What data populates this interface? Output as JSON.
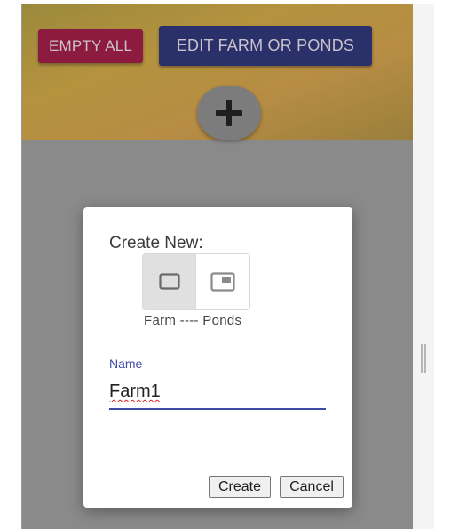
{
  "toolbar": {
    "empty_all_label": "EMPTY ALL",
    "edit_label": "EDIT FARM OR PONDS",
    "add_symbol": "+"
  },
  "dialog": {
    "title": "Create New:",
    "options": [
      {
        "icon": "square-outline-icon",
        "selected": true
      },
      {
        "icon": "picture-in-picture-icon",
        "selected": false
      }
    ],
    "options_caption": "Farm ---- Ponds",
    "name_label": "Name",
    "name_value": "Farm1",
    "create_label": "Create",
    "cancel_label": "Cancel"
  },
  "colors": {
    "accent": "#3d4aa6",
    "empty_button": "#8d1a3f",
    "edit_button": "#29306a",
    "header_band": "#b4923e"
  }
}
